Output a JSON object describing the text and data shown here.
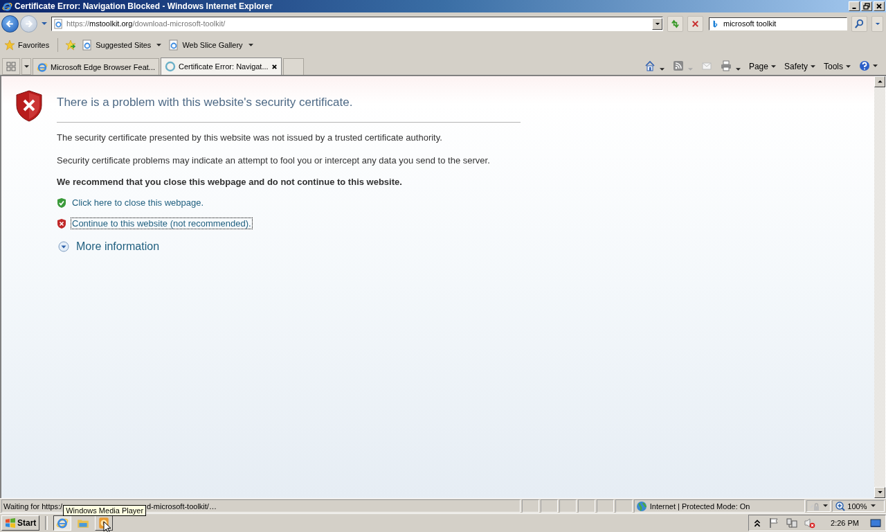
{
  "window": {
    "title": "Certificate Error: Navigation Blocked - Windows Internet Explorer"
  },
  "address": {
    "prefix": "https://",
    "domain": "mstoolkit.org",
    "path": "/download-microsoft-toolkit/"
  },
  "search": {
    "value": "microsoft toolkit"
  },
  "favorites_bar": {
    "favorites": "Favorites",
    "items": [
      {
        "label": "Suggested Sites"
      },
      {
        "label": "Web Slice Gallery"
      }
    ]
  },
  "tabs": [
    {
      "label": "Microsoft Edge Browser Feat...",
      "selected": false,
      "kind": "page"
    },
    {
      "label": "Certificate Error: Navigat...",
      "selected": true,
      "kind": "loading"
    }
  ],
  "command_bar": [
    "Page",
    "Safety",
    "Tools"
  ],
  "page": {
    "heading": "There is a problem with this website's security certificate.",
    "paragraphs": [
      "The security certificate presented by this website was not issued by a trusted certificate authority.",
      "Security certificate problems may indicate an attempt to fool you or intercept any data you send to the server."
    ],
    "recommendation": "We recommend that you close this webpage and do not continue to this website.",
    "links": [
      {
        "label": "Click here to close this webpage.",
        "kind": "safe",
        "focused": false
      },
      {
        "label": "Continue to this website (not recommended).",
        "kind": "danger",
        "focused": true
      }
    ],
    "more": "More information"
  },
  "status_bar": {
    "text_before": "Waiting for https:/",
    "text_after": "d-microsoft-toolkit/…",
    "zone": "Internet | Protected Mode: On",
    "zoom": "100%"
  },
  "tooltip": "Windows Media Player",
  "taskbar": {
    "start": "Start",
    "clock": "2:26 PM"
  }
}
